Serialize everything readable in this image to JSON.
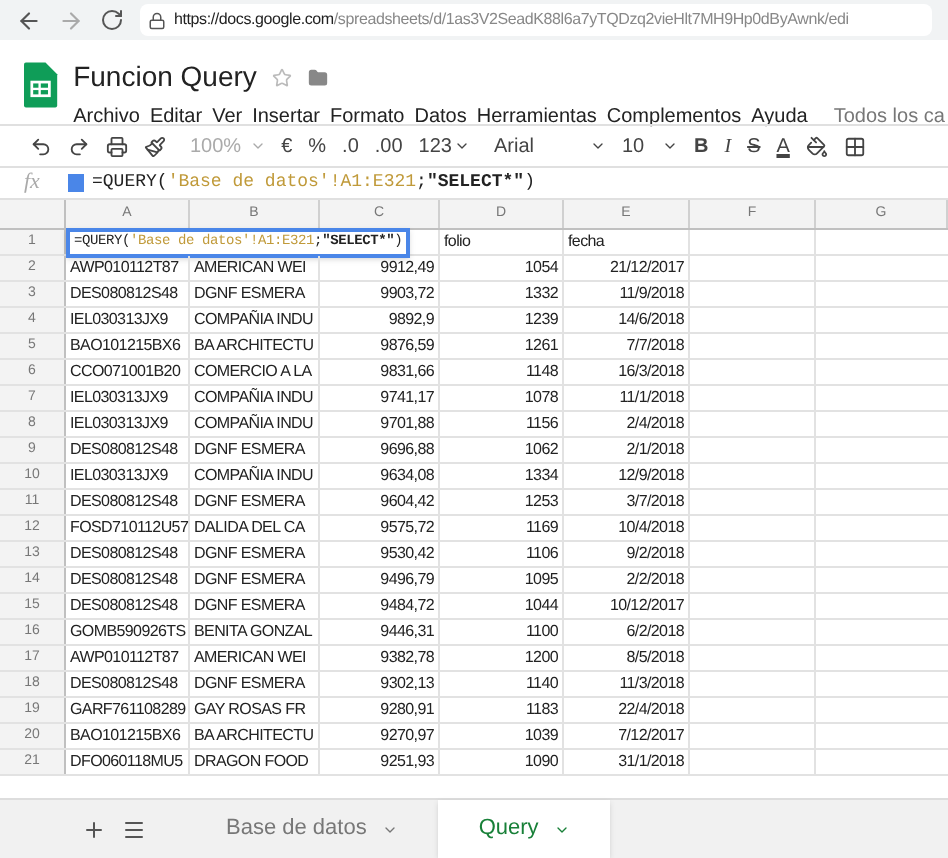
{
  "browser": {
    "url_host": "https://docs.google.com",
    "url_path": "/spreadsheets/d/1as3V2SeadK88l6a7yTQDzq2vieHlt7MH9Hp0dByAwnk/edi"
  },
  "document": {
    "title": "Funcion Query",
    "menu": [
      "Archivo",
      "Editar",
      "Ver",
      "Insertar",
      "Formato",
      "Datos",
      "Herramientas",
      "Complementos",
      "Ayuda"
    ],
    "last_edit": "Todos los ca"
  },
  "toolbar": {
    "zoom": "100%",
    "currency": "€",
    "percent": "%",
    "decimals_less": ".0",
    "decimals_more": ".00",
    "format": "123",
    "font": "Arial",
    "font_size": "10",
    "bold": "B",
    "italic": "I",
    "strike": "S",
    "text_color": "A"
  },
  "formula_bar": {
    "fx": "fx",
    "parts": [
      {
        "text": "=QUERY(",
        "kind": "plain"
      },
      {
        "text": "'Base de datos'!A1:E321",
        "kind": "range"
      },
      {
        "text": ";",
        "kind": "plain"
      },
      {
        "text": "\"SELECT*\"",
        "kind": "string"
      },
      {
        "text": ")",
        "kind": "plain"
      }
    ]
  },
  "columns": [
    "A",
    "B",
    "C",
    "D",
    "E",
    "F",
    "G"
  ],
  "rows": [
    {
      "number": "1",
      "formula_parts": [
        {
          "text": "=QUERY(",
          "kind": "plain"
        },
        {
          "text": "'Base de datos'!A1:E321",
          "kind": "range"
        },
        {
          "text": ";",
          "kind": "plain"
        },
        {
          "text": "\"SELECT*\"",
          "kind": "string"
        },
        {
          "text": ")",
          "kind": "plain"
        }
      ],
      "cells": [
        "",
        "",
        "",
        "folio",
        "fecha"
      ]
    },
    {
      "number": "2",
      "cells": [
        "AWP010112T87",
        "AMERICAN WEI",
        "9912,49",
        "1054",
        "21/12/2017"
      ]
    },
    {
      "number": "3",
      "cells": [
        "DES080812S48",
        "DGNF ESMERA",
        "9903,72",
        "1332",
        "11/9/2018"
      ]
    },
    {
      "number": "4",
      "cells": [
        "IEL030313JX9",
        "COMPAÑIA INDU",
        "9892,9",
        "1239",
        "14/6/2018"
      ]
    },
    {
      "number": "5",
      "cells": [
        "BAO101215BX6",
        "BA ARCHITECTU",
        "9876,59",
        "1261",
        "7/7/2018"
      ]
    },
    {
      "number": "6",
      "cells": [
        "CCO071001B20",
        "COMERCIO A LA",
        "9831,66",
        "1148",
        "16/3/2018"
      ]
    },
    {
      "number": "7",
      "cells": [
        "IEL030313JX9",
        "COMPAÑIA INDU",
        "9741,17",
        "1078",
        "11/1/2018"
      ]
    },
    {
      "number": "8",
      "cells": [
        "IEL030313JX9",
        "COMPAÑIA INDU",
        "9701,88",
        "1156",
        "2/4/2018"
      ]
    },
    {
      "number": "9",
      "cells": [
        "DES080812S48",
        "DGNF ESMERA",
        "9696,88",
        "1062",
        "2/1/2018"
      ]
    },
    {
      "number": "10",
      "cells": [
        "IEL030313JX9",
        "COMPAÑIA INDU",
        "9634,08",
        "1334",
        "12/9/2018"
      ]
    },
    {
      "number": "11",
      "cells": [
        "DES080812S48",
        "DGNF ESMERA",
        "9604,42",
        "1253",
        "3/7/2018"
      ]
    },
    {
      "number": "12",
      "cells": [
        "FOSD710112U57",
        "DALIDA DEL CA",
        "9575,72",
        "1169",
        "10/4/2018"
      ]
    },
    {
      "number": "13",
      "cells": [
        "DES080812S48",
        "DGNF ESMERA",
        "9530,42",
        "1106",
        "9/2/2018"
      ]
    },
    {
      "number": "14",
      "cells": [
        "DES080812S48",
        "DGNF ESMERA",
        "9496,79",
        "1095",
        "2/2/2018"
      ]
    },
    {
      "number": "15",
      "cells": [
        "DES080812S48",
        "DGNF ESMERA",
        "9484,72",
        "1044",
        "10/12/2017"
      ]
    },
    {
      "number": "16",
      "cells": [
        "GOMB590926TS",
        "BENITA GONZAL",
        "9446,31",
        "1100",
        "6/2/2018"
      ]
    },
    {
      "number": "17",
      "cells": [
        "AWP010112T87",
        "AMERICAN WEI",
        "9382,78",
        "1200",
        "8/5/2018"
      ]
    },
    {
      "number": "18",
      "cells": [
        "DES080812S48",
        "DGNF ESMERA",
        "9302,13",
        "1140",
        "11/3/2018"
      ]
    },
    {
      "number": "19",
      "cells": [
        "GARF761108289",
        "GAY ROSAS FR",
        "9280,91",
        "1183",
        "22/4/2018"
      ]
    },
    {
      "number": "20",
      "cells": [
        "BAO101215BX6",
        "BA ARCHITECTU",
        "9270,97",
        "1039",
        "7/12/2017"
      ]
    },
    {
      "number": "21",
      "cells": [
        "DFO060118MU5",
        "DRAGON FOOD",
        "9251,93",
        "1090",
        "31/1/2018"
      ]
    }
  ],
  "sheets": [
    {
      "name": "Base de datos",
      "selected": false
    },
    {
      "name": "Query",
      "selected": true
    }
  ]
}
